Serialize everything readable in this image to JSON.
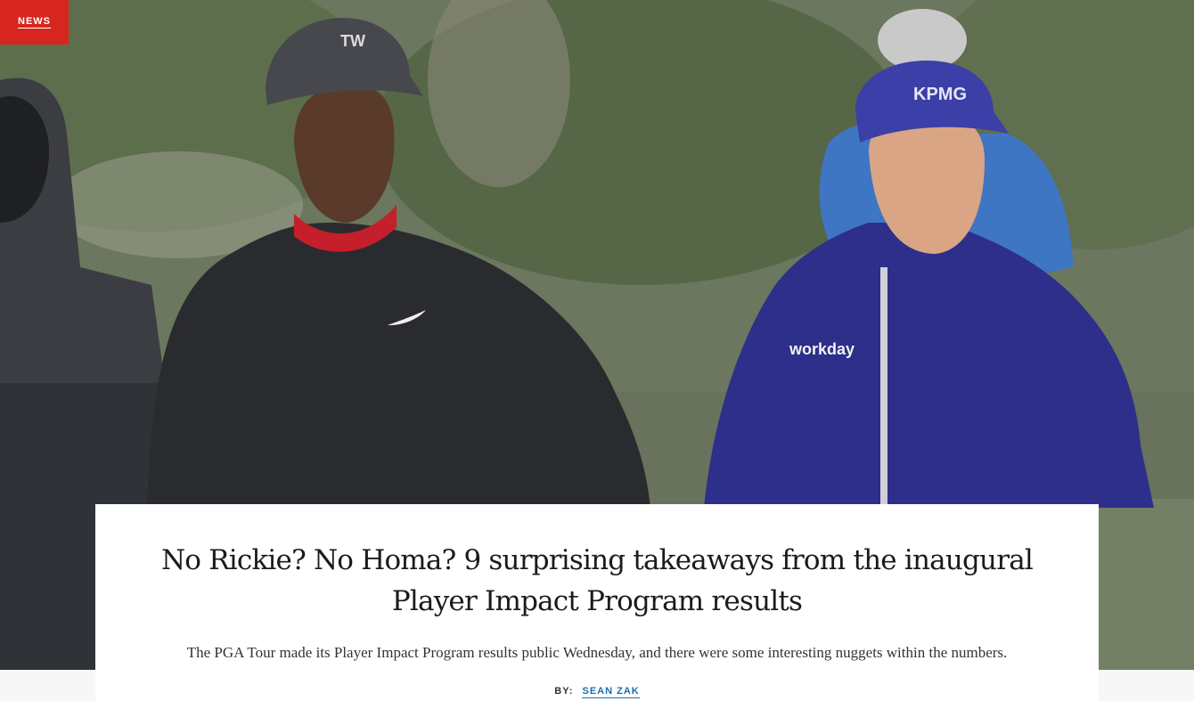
{
  "article": {
    "category": "NEWS",
    "headline": "No Rickie? No Homa? 9 surprising takeaways from the inaugural Player Impact Program results",
    "dek": "The PGA Tour made its Player Impact Program results public Wednesday, and there were some interesting nuggets within the numbers.",
    "byline_label": "BY:",
    "author": "SEAN ZAK"
  },
  "hero_image": {
    "cap_logo_left": "TW",
    "cap_logo_right": "KPMG",
    "chest_logo_right": "workday"
  },
  "colors": {
    "badge_red": "#d7261e",
    "author_link": "#1a6fb0"
  }
}
